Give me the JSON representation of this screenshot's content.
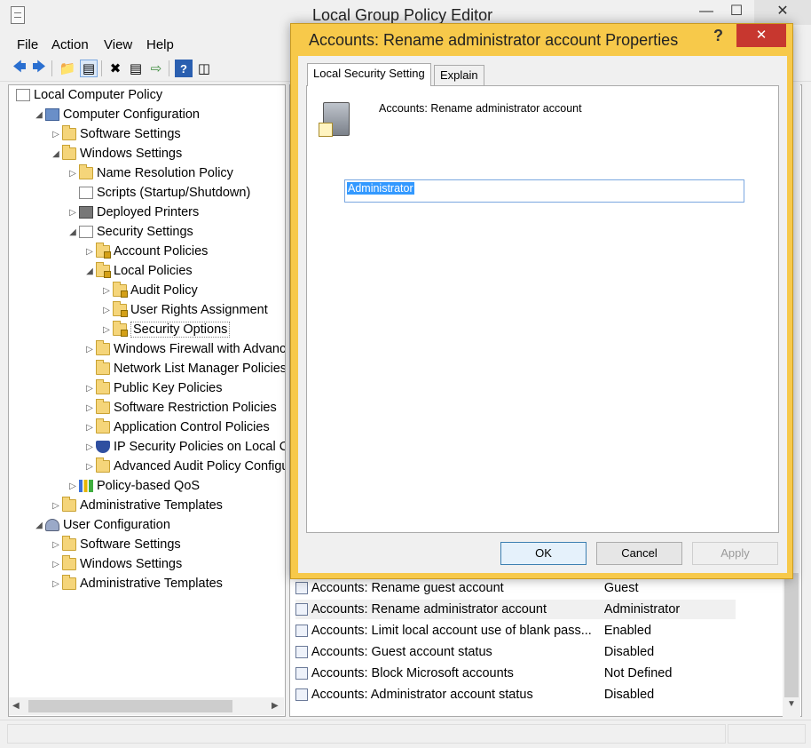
{
  "window": {
    "title": "Local Group Policy Editor"
  },
  "menu": [
    "File",
    "Action",
    "View",
    "Help"
  ],
  "tree": [
    {
      "label": "Local Computer Policy",
      "indent": 0,
      "arrow": "",
      "icon": "doc"
    },
    {
      "label": "Computer Configuration",
      "indent": 1,
      "arrow": "expanded",
      "icon": "computer"
    },
    {
      "label": "Software Settings",
      "indent": 2,
      "arrow": "collapsed",
      "icon": "folder"
    },
    {
      "label": "Windows Settings",
      "indent": 2,
      "arrow": "expanded",
      "icon": "folder"
    },
    {
      "label": "Name Resolution Policy",
      "indent": 3,
      "arrow": "collapsed",
      "icon": "folder"
    },
    {
      "label": "Scripts (Startup/Shutdown)",
      "indent": 3,
      "arrow": "",
      "icon": "doc"
    },
    {
      "label": "Deployed Printers",
      "indent": 3,
      "arrow": "collapsed",
      "icon": "printer"
    },
    {
      "label": "Security Settings",
      "indent": 3,
      "arrow": "expanded",
      "icon": "doc"
    },
    {
      "label": "Account Policies",
      "indent": 4,
      "arrow": "collapsed",
      "icon": "folder-lock"
    },
    {
      "label": "Local Policies",
      "indent": 4,
      "arrow": "expanded",
      "icon": "folder-lock"
    },
    {
      "label": "Audit Policy",
      "indent": 5,
      "arrow": "collapsed",
      "icon": "folder-lock"
    },
    {
      "label": "User Rights Assignment",
      "indent": 5,
      "arrow": "collapsed",
      "icon": "folder-lock"
    },
    {
      "label": "Security Options",
      "indent": 5,
      "arrow": "collapsed",
      "icon": "folder-lock",
      "selected": true
    },
    {
      "label": "Windows Firewall with Advance",
      "indent": 4,
      "arrow": "collapsed",
      "icon": "folder"
    },
    {
      "label": "Network List Manager Policies",
      "indent": 4,
      "arrow": "",
      "icon": "folder"
    },
    {
      "label": "Public Key Policies",
      "indent": 4,
      "arrow": "collapsed",
      "icon": "folder"
    },
    {
      "label": "Software Restriction Policies",
      "indent": 4,
      "arrow": "collapsed",
      "icon": "folder"
    },
    {
      "label": "Application Control Policies",
      "indent": 4,
      "arrow": "collapsed",
      "icon": "folder"
    },
    {
      "label": "IP Security Policies on Local Cor",
      "indent": 4,
      "arrow": "collapsed",
      "icon": "shield"
    },
    {
      "label": "Advanced Audit Policy Configur",
      "indent": 4,
      "arrow": "collapsed",
      "icon": "folder"
    },
    {
      "label": "Policy-based QoS",
      "indent": 3,
      "arrow": "collapsed",
      "icon": "chart"
    },
    {
      "label": "Administrative Templates",
      "indent": 2,
      "arrow": "collapsed",
      "icon": "folder"
    },
    {
      "label": "User Configuration",
      "indent": 1,
      "arrow": "expanded",
      "icon": "user"
    },
    {
      "label": "Software Settings",
      "indent": 2,
      "arrow": "collapsed",
      "icon": "folder"
    },
    {
      "label": "Windows Settings",
      "indent": 2,
      "arrow": "collapsed",
      "icon": "folder"
    },
    {
      "label": "Administrative Templates",
      "indent": 2,
      "arrow": "collapsed",
      "icon": "folder"
    }
  ],
  "policies": [
    {
      "name": "Accounts: Rename guest account",
      "value": "Guest"
    },
    {
      "name": "Accounts: Rename administrator account",
      "value": "Administrator",
      "highlighted": true
    },
    {
      "name": "Accounts: Limit local account use of blank pass...",
      "value": "Enabled"
    },
    {
      "name": "Accounts: Guest account status",
      "value": "Disabled"
    },
    {
      "name": "Accounts: Block Microsoft accounts",
      "value": "Not Defined"
    },
    {
      "name": "Accounts: Administrator account status",
      "value": "Disabled"
    }
  ],
  "dialog": {
    "title": "Accounts: Rename administrator account Properties",
    "help": "?",
    "close": "✕",
    "tabs": {
      "active": "Local Security Setting",
      "inactive": "Explain"
    },
    "policy_label": "Accounts: Rename administrator account",
    "value": "Administrator",
    "buttons": {
      "ok": "OK",
      "cancel": "Cancel",
      "apply": "Apply"
    }
  },
  "colors": {
    "dialog_frame": "#f7c94a",
    "close_button": "#c7372f",
    "selection": "#3399ff"
  }
}
